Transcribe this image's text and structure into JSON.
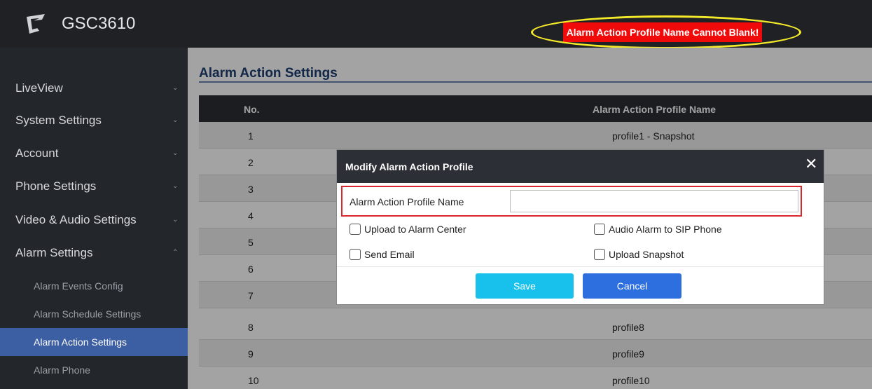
{
  "app": {
    "title": "GSC3610"
  },
  "alert": {
    "text": "Alarm Action Profile Name Cannot Blank!"
  },
  "sidebar": {
    "items": [
      {
        "label": "LiveView"
      },
      {
        "label": "System Settings"
      },
      {
        "label": "Account"
      },
      {
        "label": "Phone Settings"
      },
      {
        "label": "Video & Audio Settings"
      },
      {
        "label": "Alarm Settings"
      }
    ],
    "sub_items": [
      {
        "label": "Alarm Events Config"
      },
      {
        "label": "Alarm Schedule Settings"
      },
      {
        "label": "Alarm Action Settings"
      },
      {
        "label": "Alarm Phone"
      }
    ],
    "chevron_down": "⌄",
    "chevron_up": "⌃"
  },
  "page": {
    "title": "Alarm Action Settings",
    "table": {
      "headers": [
        "No.",
        "Alarm Action Profile Name"
      ],
      "rows": [
        {
          "no": "1",
          "name": "profile1 - Snapshot"
        },
        {
          "no": "2",
          "name": ""
        },
        {
          "no": "3",
          "name": ""
        },
        {
          "no": "4",
          "name": ""
        },
        {
          "no": "5",
          "name": ""
        },
        {
          "no": "6",
          "name": ""
        },
        {
          "no": "7",
          "name": ""
        },
        {
          "no": "8",
          "name": "profile8"
        },
        {
          "no": "9",
          "name": "profile9"
        },
        {
          "no": "10",
          "name": "profile10"
        }
      ]
    }
  },
  "modal": {
    "title": "Modify Alarm Action Profile",
    "close": "✕",
    "name_label": "Alarm Action Profile Name",
    "name_value": "",
    "checkboxes": [
      {
        "label": "Upload to Alarm Center",
        "checked": false
      },
      {
        "label": "Audio Alarm to SIP Phone",
        "checked": false
      },
      {
        "label": "Send Email",
        "checked": false
      },
      {
        "label": "Upload Snapshot",
        "checked": false
      }
    ],
    "save_label": "Save",
    "cancel_label": "Cancel"
  },
  "colors": {
    "topbar": "#1f2125",
    "sidebar": "#23262b",
    "sidebar_active": "#3c5fa3",
    "alert_bg": "#f00a0a",
    "alert_ring": "#f4ea2a",
    "save_button": "#17c1ec",
    "cancel_button": "#2e6fe0",
    "highlight_box": "#d9262f"
  }
}
